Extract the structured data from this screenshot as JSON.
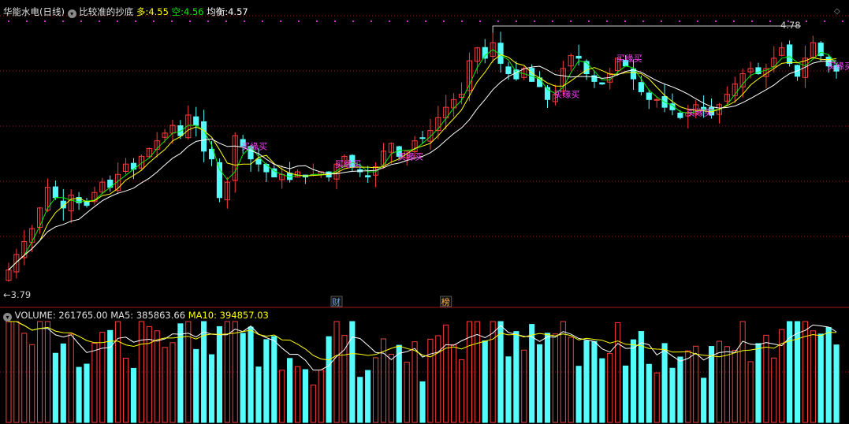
{
  "header": {
    "stock_name": "华能水电(日线)",
    "indicator": "比较准的抄底",
    "long_label": "多:",
    "long_value": "4.55",
    "short_label": "空:",
    "short_value": "4.56",
    "balance_label": "均衡:",
    "balance_value": "4.57"
  },
  "volume_header": {
    "vol_label": "VOLUME:",
    "vol_value": "261765.00",
    "ma5_label": "MA5:",
    "ma5_value": "385863.66",
    "ma10_label": "MA10:",
    "ma10_value": "394857.03"
  },
  "colors": {
    "up": "#ff3c3c",
    "down": "#54fcfc",
    "ma_white": "#ffffff",
    "ma_yellow": "#ffff00",
    "ma_green": "#00ee00",
    "signal": "#ff44ff",
    "grid": "#a01818"
  },
  "chart_data": {
    "type": "candlestick",
    "high_marker": "4.78",
    "low_marker": "3.79",
    "signal_label": "买缘买",
    "signals": [
      30,
      42,
      50,
      70,
      78,
      87,
      105
    ],
    "event_markers": [
      {
        "index": 42,
        "label": "财"
      },
      {
        "index": 56,
        "label": "榜"
      }
    ],
    "closes": [
      3.84,
      3.9,
      3.95,
      4.0,
      4.08,
      4.16,
      4.12,
      4.08,
      4.13,
      4.1,
      4.09,
      4.14,
      4.18,
      4.16,
      4.21,
      4.25,
      4.23,
      4.28,
      4.31,
      4.34,
      4.37,
      4.4,
      4.36,
      4.44,
      4.4,
      4.3,
      4.27,
      4.12,
      4.18,
      4.36,
      4.32,
      4.27,
      4.25,
      4.22,
      4.2,
      4.21,
      4.19,
      4.22,
      4.2,
      4.21,
      4.22,
      4.2,
      4.25,
      4.28,
      4.24,
      4.22,
      4.2,
      4.24,
      4.3,
      4.33,
      4.28,
      4.3,
      4.34,
      4.35,
      4.38,
      4.43,
      4.47,
      4.5,
      4.52,
      4.65,
      4.7,
      4.66,
      4.72,
      4.64,
      4.6,
      4.58,
      4.62,
      4.57,
      4.55,
      4.5,
      4.52,
      4.62,
      4.67,
      4.66,
      4.6,
      4.57,
      4.56,
      4.6,
      4.66,
      4.63,
      4.58,
      4.53,
      4.5,
      4.5,
      4.47,
      4.46,
      4.43,
      4.45,
      4.48,
      4.46,
      4.44,
      4.48,
      4.52,
      4.56,
      4.6,
      4.62,
      4.6,
      4.62,
      4.66,
      4.7,
      4.64,
      4.59,
      4.66,
      4.72,
      4.67,
      4.63,
      4.61
    ]
  }
}
